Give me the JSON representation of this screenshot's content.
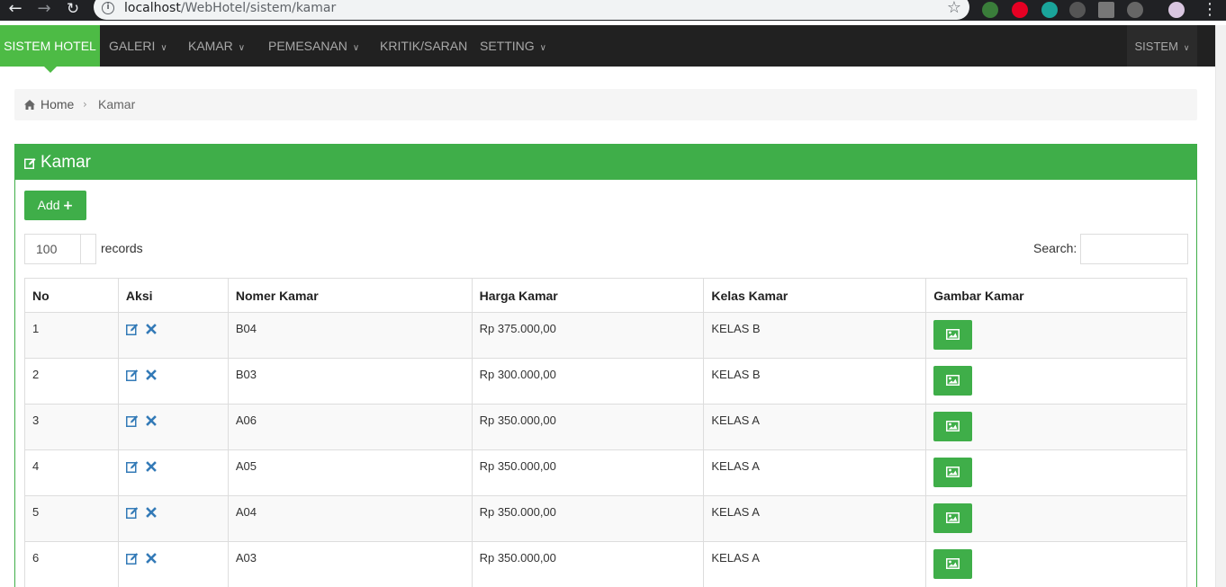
{
  "browser": {
    "url_host": "localhost",
    "url_path": "/WebHotel/sistem/kamar"
  },
  "navbar": {
    "brand": "SISTEM HOTEL",
    "items": [
      {
        "label": "GALERI",
        "dropdown": true
      },
      {
        "label": "KAMAR",
        "dropdown": true
      },
      {
        "label": "PEMESANAN",
        "dropdown": true
      },
      {
        "label": "KRITIK/SARAN",
        "dropdown": false
      },
      {
        "label": "SETTING",
        "dropdown": true
      }
    ],
    "right": {
      "label": "SISTEM",
      "dropdown": true
    }
  },
  "breadcrumb": {
    "home": "Home",
    "current": "Kamar"
  },
  "panel": {
    "title": "Kamar",
    "add_label": "Add",
    "length_value": "100",
    "records_label": "records",
    "search_label": "Search:"
  },
  "table": {
    "headers": [
      "No",
      "Aksi",
      "Nomer Kamar",
      "Harga Kamar",
      "Kelas Kamar",
      "Gambar Kamar"
    ],
    "rows": [
      {
        "no": "1",
        "nomer": "B04",
        "harga": "Rp 375.000,00",
        "kelas": "KELAS B"
      },
      {
        "no": "2",
        "nomer": "B03",
        "harga": "Rp 300.000,00",
        "kelas": "KELAS B"
      },
      {
        "no": "3",
        "nomer": "A06",
        "harga": "Rp 350.000,00",
        "kelas": "KELAS A"
      },
      {
        "no": "4",
        "nomer": "A05",
        "harga": "Rp 350.000,00",
        "kelas": "KELAS A"
      },
      {
        "no": "5",
        "nomer": "A04",
        "harga": "Rp 350.000,00",
        "kelas": "KELAS A"
      },
      {
        "no": "6",
        "nomer": "A03",
        "harga": "Rp 350.000,00",
        "kelas": "KELAS A"
      }
    ]
  },
  "colors": {
    "brand_green": "#4dbb45",
    "panel_green": "#3fae49",
    "navbar_bg": "#212121",
    "action_blue": "#337ab7"
  },
  "icons": {
    "edit": "pencil-square-icon",
    "delete": "times-icon",
    "image": "picture-icon",
    "home": "home-icon"
  }
}
